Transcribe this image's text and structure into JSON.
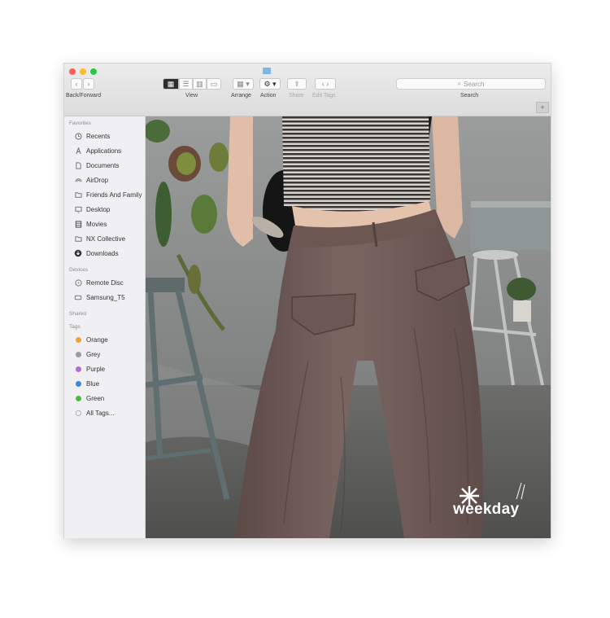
{
  "toolbar": {
    "back_forward_label": "Back/Forward",
    "view_label": "View",
    "arrange_label": "Arrange",
    "action_label": "Action",
    "share_label": "Share",
    "edit_tags_label": "Edit Tags",
    "search_placeholder": "Search",
    "search_label": "Search"
  },
  "sidebar": {
    "favorites_title": "Favorites",
    "favorites": [
      {
        "label": "Recents",
        "icon": "clock-icon"
      },
      {
        "label": "Applications",
        "icon": "applications-icon"
      },
      {
        "label": "Documents",
        "icon": "document-icon"
      },
      {
        "label": "AirDrop",
        "icon": "airdrop-icon"
      },
      {
        "label": "Friends And Family",
        "icon": "folder-icon"
      },
      {
        "label": "Desktop",
        "icon": "desktop-icon"
      },
      {
        "label": "Movies",
        "icon": "film-icon"
      },
      {
        "label": "NX Collective",
        "icon": "folder-icon"
      },
      {
        "label": "Downloads",
        "icon": "download-icon"
      }
    ],
    "devices_title": "Devices",
    "devices": [
      {
        "label": "Remote Disc",
        "icon": "disc-icon"
      },
      {
        "label": "Samsung_T5",
        "icon": "drive-icon"
      }
    ],
    "shared_title": "Shared",
    "tags_title": "Tags",
    "tags": [
      {
        "label": "Orange",
        "color": "#f0a22e"
      },
      {
        "label": "Grey",
        "color": "#9b9b9b"
      },
      {
        "label": "Purple",
        "color": "#b76ad2"
      },
      {
        "label": "Blue",
        "color": "#3b86e0"
      },
      {
        "label": "Green",
        "color": "#4cbb45"
      }
    ],
    "all_tags_label": "All Tags..."
  },
  "photo": {
    "brand_text": "weekday"
  },
  "colors": {
    "pants": "#6e5a56",
    "wall": "#8d9190",
    "floor": "#5e5f5d"
  }
}
